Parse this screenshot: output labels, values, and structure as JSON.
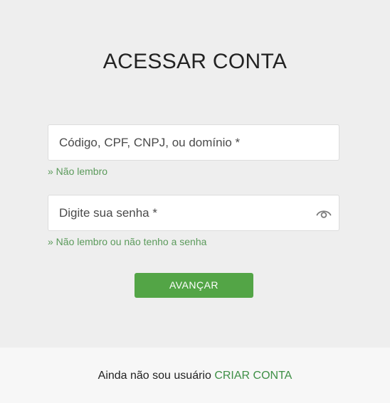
{
  "login": {
    "title": "ACESSAR CONTA",
    "user_field": {
      "placeholder": "Código, CPF, CNPJ, ou domínio *",
      "value": "",
      "help_link": "» Não lembro"
    },
    "password_field": {
      "placeholder": "Digite sua senha *",
      "value": "",
      "toggle_icon": "eye-icon",
      "help_link": "» Não lembro ou não tenho a senha"
    },
    "submit_label": "AVANÇAR"
  },
  "footer": {
    "prompt": "Ainda não sou usuário",
    "create_account_link": "CRIAR CONTA"
  },
  "colors": {
    "background": "#eeeeee",
    "footer_background": "#f7f7f7",
    "primary_button": "#53a546",
    "link_green": "#5b9a5b",
    "footer_link": "#3e8f46"
  }
}
